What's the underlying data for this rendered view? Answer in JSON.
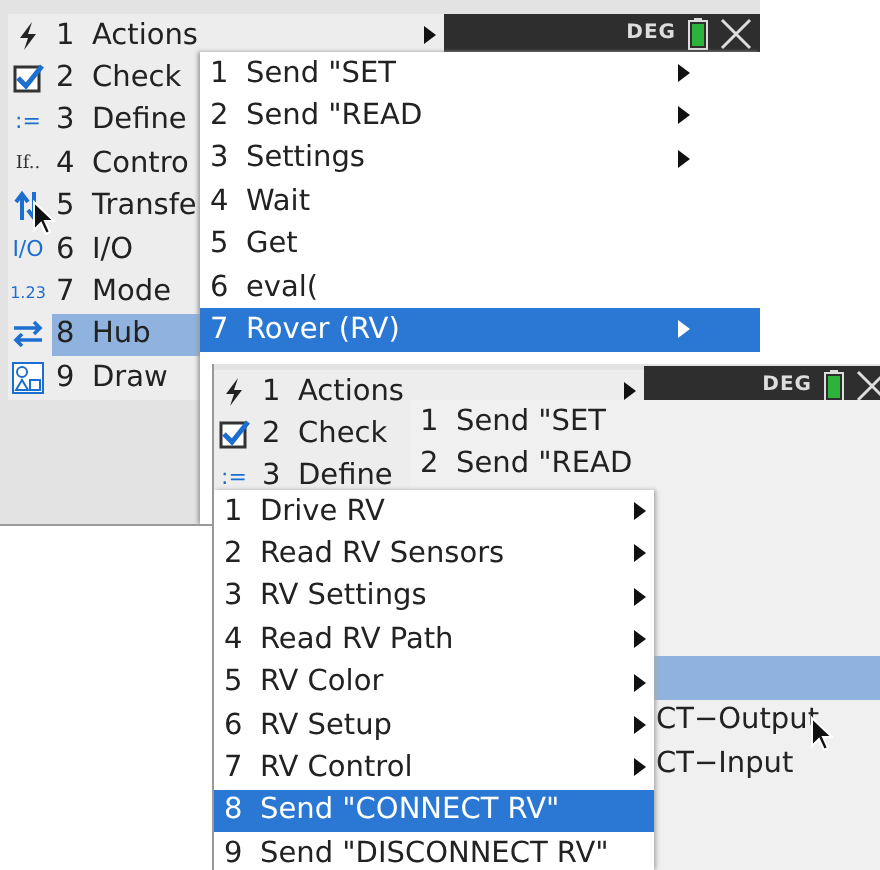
{
  "screens": [
    {
      "status": {
        "mode": "DEG"
      },
      "menus": [
        {
          "kind": "main",
          "active": false,
          "items": [
            {
              "number": "1",
              "label": "Actions",
              "submenu": true,
              "selected": false
            },
            {
              "number": "2",
              "label": "Check",
              "selected": false
            },
            {
              "glyph": ":=",
              "number": "3",
              "label": "Define",
              "selected": false
            },
            {
              "glyph": "If..",
              "number": "4",
              "label": "Contro",
              "selected": false
            },
            {
              "number": "5",
              "label": "Transfe",
              "selected": false
            },
            {
              "glyph": "I/O",
              "number": "6",
              "label": "I/O",
              "selected": false
            },
            {
              "glyph": "1.23",
              "number": "7",
              "label": "Mode",
              "selected": false
            },
            {
              "number": "8",
              "label": "Hub",
              "selected": true
            },
            {
              "number": "9",
              "label": "Draw",
              "selected": false
            }
          ]
        },
        {
          "kind": "sub",
          "active": true,
          "items": [
            {
              "number": "1",
              "label": "Send \"SET",
              "submenu": true,
              "selected": false
            },
            {
              "number": "2",
              "label": "Send \"READ",
              "submenu": true,
              "selected": false
            },
            {
              "number": "3",
              "label": "Settings",
              "submenu": true,
              "selected": false
            },
            {
              "number": "4",
              "label": "Wait",
              "selected": false
            },
            {
              "number": "5",
              "label": "Get",
              "selected": false
            },
            {
              "number": "6",
              "label": "eval(",
              "selected": false
            },
            {
              "number": "7",
              "label": "Rover (RV)",
              "submenu": true,
              "selected": true
            }
          ]
        }
      ]
    },
    {
      "status": {
        "mode": "DEG"
      },
      "menus": [
        {
          "kind": "main",
          "items": [
            {
              "number": "1",
              "label": "Actions",
              "submenu": true,
              "selected": false
            },
            {
              "number": "2",
              "label": "Check",
              "selected": false
            },
            {
              "glyph": ":=",
              "number": "3",
              "label": "Define",
              "selected": false
            }
          ]
        },
        {
          "kind": "sub",
          "active": false,
          "items": [
            {
              "number": "1",
              "label": "Send \"SET",
              "selected": false
            },
            {
              "number": "2",
              "label": "Send \"READ",
              "selected": false
            },
            {
              "selected": false
            },
            {
              "selected": false
            },
            {
              "selected": false
            },
            {
              "selected": false
            },
            {
              "selected": true
            },
            {
              "label": "CT−Output",
              "selected": false
            },
            {
              "label": "CT−Input",
              "selected": false
            }
          ]
        },
        {
          "kind": "sub",
          "active": true,
          "items": [
            {
              "number": "1",
              "label": "Drive RV",
              "submenu": true,
              "selected": false
            },
            {
              "number": "2",
              "label": "Read RV Sensors",
              "submenu": true,
              "selected": false
            },
            {
              "number": "3",
              "label": "RV Settings",
              "submenu": true,
              "selected": false
            },
            {
              "number": "4",
              "label": "Read RV Path",
              "submenu": true,
              "selected": false
            },
            {
              "number": "5",
              "label": "RV Color",
              "submenu": true,
              "selected": false
            },
            {
              "number": "6",
              "label": "RV Setup",
              "submenu": true,
              "selected": false
            },
            {
              "number": "7",
              "label": "RV Control",
              "submenu": true,
              "selected": false
            },
            {
              "number": "8",
              "label": "Send \"CONNECT RV\"",
              "selected": true
            },
            {
              "number": "9",
              "label": "Send \"DISCONNECT RV\"",
              "selected": false
            }
          ]
        }
      ]
    }
  ]
}
